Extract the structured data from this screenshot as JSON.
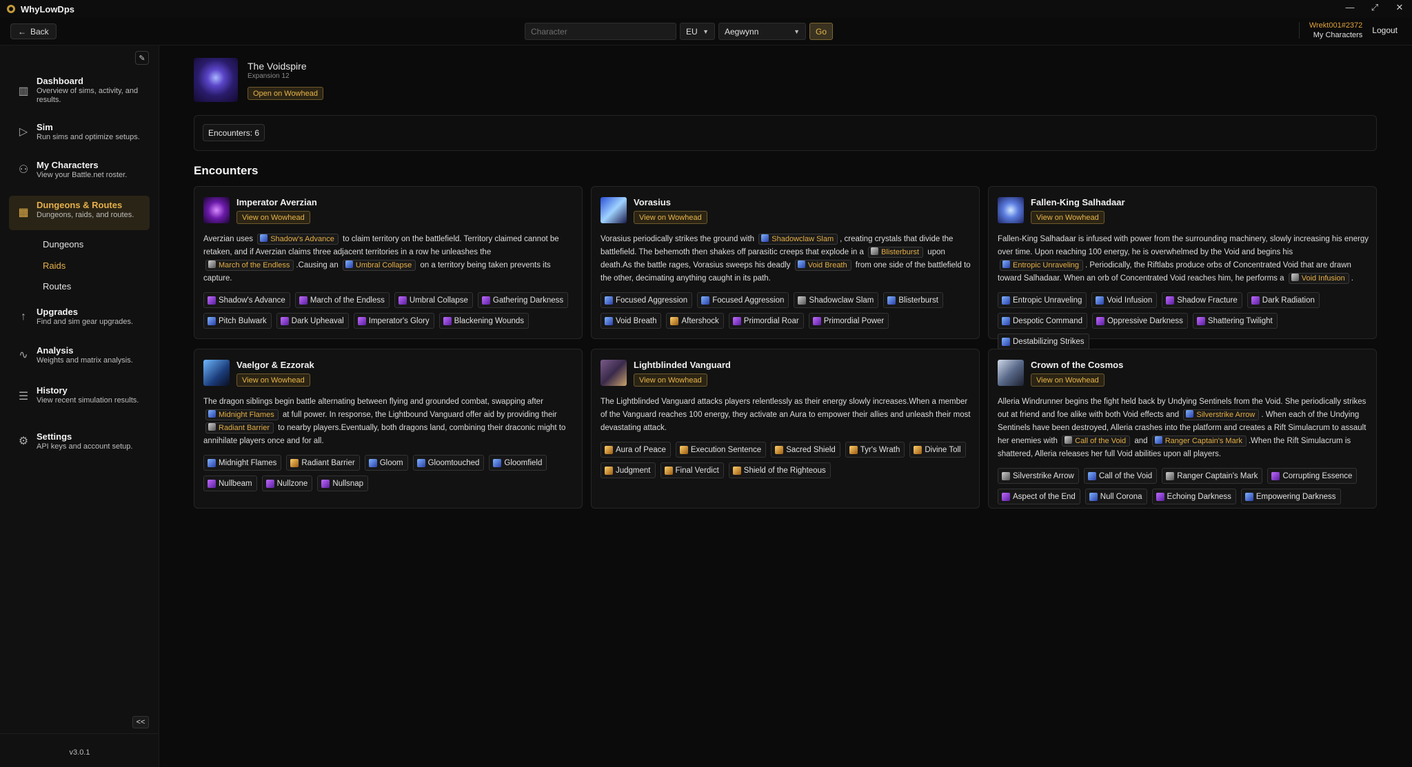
{
  "app": {
    "title": "WhyLowDps"
  },
  "window_controls": {
    "minimize": "—",
    "restore": "⤢",
    "close": "✕"
  },
  "topbar": {
    "back_label": "Back",
    "character_placeholder": "Character",
    "region": "EU",
    "realm": "Aegwynn",
    "go_label": "Go",
    "user_tag": "Wrekt001#2372",
    "my_characters": "My Characters",
    "logout": "Logout"
  },
  "sidebar": {
    "items": [
      {
        "title": "Dashboard",
        "sub": "Overview of sims, activity, and results.",
        "icon": "chart-bar-icon"
      },
      {
        "title": "Sim",
        "sub": "Run sims and optimize setups.",
        "icon": "play-icon"
      },
      {
        "title": "My Characters",
        "sub": "View your Battle.net roster.",
        "icon": "users-icon"
      },
      {
        "title": "Dungeons & Routes",
        "sub": "Dungeons, raids, and routes.",
        "icon": "map-icon"
      },
      {
        "title": "Upgrades",
        "sub": "Find and sim gear upgrades.",
        "icon": "arrow-up-icon"
      },
      {
        "title": "Analysis",
        "sub": "Weights and matrix analysis.",
        "icon": "line-chart-icon"
      },
      {
        "title": "History",
        "sub": "View recent simulation results.",
        "icon": "history-icon"
      },
      {
        "title": "Settings",
        "sub": "API keys and account setup.",
        "icon": "gear-icon"
      }
    ],
    "subitems": [
      "Dungeons",
      "Raids",
      "Routes"
    ],
    "collapse_label": "<<",
    "version": "v3.0.1"
  },
  "instance": {
    "title": "The Voidspire",
    "subtitle": "Expansion 12",
    "wowhead_label": "Open on Wowhead",
    "encounter_count": "Encounters: 6"
  },
  "encounters_heading": "Encounters",
  "view_wowhead": "View on Wowhead",
  "encounters": [
    {
      "name": "Imperator Averzian",
      "desc": [
        {
          "t": "Averzian uses "
        },
        {
          "a": "Shadow's Advance"
        },
        {
          "t": " to claim territory on the battlefield. Territory claimed cannot be retaken, and if Averzian claims three adjacent territories in a row he unleashes the "
        },
        {
          "a": "March of the Endless"
        },
        {
          "t": ".Causing an "
        },
        {
          "a": "Umbral Collapse"
        },
        {
          "t": " on a territory being taken prevents its capture."
        }
      ],
      "abilities": [
        "Shadow's Advance",
        "March of the Endless",
        "Umbral Collapse",
        "Gathering Darkness",
        "Pitch Bulwark",
        "Dark Upheaval",
        "Imperator's Glory",
        "Blackening Wounds"
      ]
    },
    {
      "name": "Vorasius",
      "desc": [
        {
          "t": "Vorasius periodically strikes the ground with "
        },
        {
          "a": "Shadowclaw Slam"
        },
        {
          "t": ", creating crystals that divide the battlefield. The behemoth then shakes off parasitic creeps that explode in a "
        },
        {
          "a": "Blisterburst"
        },
        {
          "t": " upon death.As the battle rages, Vorasius sweeps his deadly "
        },
        {
          "a": "Void Breath"
        },
        {
          "t": " from one side of the battlefield to the other, decimating anything caught in its path."
        }
      ],
      "abilities": [
        "Focused Aggression",
        "Focused Aggression",
        "Shadowclaw Slam",
        "Blisterburst",
        "Void Breath",
        "Aftershock",
        "Primordial Roar",
        "Primordial Power"
      ]
    },
    {
      "name": "Fallen-King Salhadaar",
      "desc": [
        {
          "t": "Fallen-King Salhadaar is infused with power from the surrounding machinery, slowly increasing his energy over time. Upon reaching 100 energy, he is overwhelmed by the Void and begins his "
        },
        {
          "a": "Entropic Unraveling"
        },
        {
          "t": ". Periodically, the Riftlabs produce orbs of Concentrated Void that are drawn toward Salhadaar. When an orb of Concentrated Void reaches him, he performs a "
        },
        {
          "a": "Void Infusion"
        },
        {
          "t": "."
        }
      ],
      "abilities": [
        "Entropic Unraveling",
        "Void Infusion",
        "Shadow Fracture",
        "Dark Radiation",
        "Despotic Command",
        "Oppressive Darkness",
        "Shattering Twilight",
        "Destabilizing Strikes"
      ]
    },
    {
      "name": "Vaelgor & Ezzorak",
      "desc": [
        {
          "t": "The dragon siblings begin battle alternating between flying and grounded combat, swapping after "
        },
        {
          "a": "Midnight Flames"
        },
        {
          "t": " at full power. In response, the Lightbound Vanguard offer aid by providing their "
        },
        {
          "a": "Radiant Barrier"
        },
        {
          "t": " to nearby players.Eventually, both dragons land, combining their draconic might to annihilate players once and for all."
        }
      ],
      "abilities": [
        "Midnight Flames",
        "Radiant Barrier",
        "Gloom",
        "Gloomtouched",
        "Gloomfield",
        "Nullbeam",
        "Nullzone",
        "Nullsnap"
      ]
    },
    {
      "name": "Lightblinded Vanguard",
      "desc": [
        {
          "t": "The Lightblinded Vanguard attacks players relentlessly as their energy slowly increases.When a member of the Vanguard reaches 100 energy, they activate an Aura to empower their allies and unleash their most devastating attack."
        }
      ],
      "abilities": [
        "Aura of Peace",
        "Execution Sentence",
        "Sacred Shield",
        "Tyr's Wrath",
        "Divine Toll",
        "Judgment",
        "Final Verdict",
        "Shield of the Righteous"
      ]
    },
    {
      "name": "Crown of the Cosmos",
      "desc": [
        {
          "t": "Alleria Windrunner begins the fight held back by Undying Sentinels from the Void. She periodically strikes out at friend and foe alike with both Void effects and "
        },
        {
          "a": "Silverstrike Arrow"
        },
        {
          "t": ". When each of the Undying Sentinels have been destroyed, Alleria crashes into the platform and creates a Rift Simulacrum to assault her enemies with "
        },
        {
          "a": "Call of the Void"
        },
        {
          "t": " and "
        },
        {
          "a": "Ranger Captain's Mark"
        },
        {
          "t": ".When the Rift Simulacrum is shattered, Alleria releases her full Void abilities upon all players."
        }
      ],
      "abilities": [
        "Silverstrike Arrow",
        "Call of the Void",
        "Ranger Captain's Mark",
        "Corrupting Essence",
        "Aspect of the End",
        "Null Corona",
        "Echoing Darkness",
        "Empowering Darkness"
      ]
    }
  ]
}
